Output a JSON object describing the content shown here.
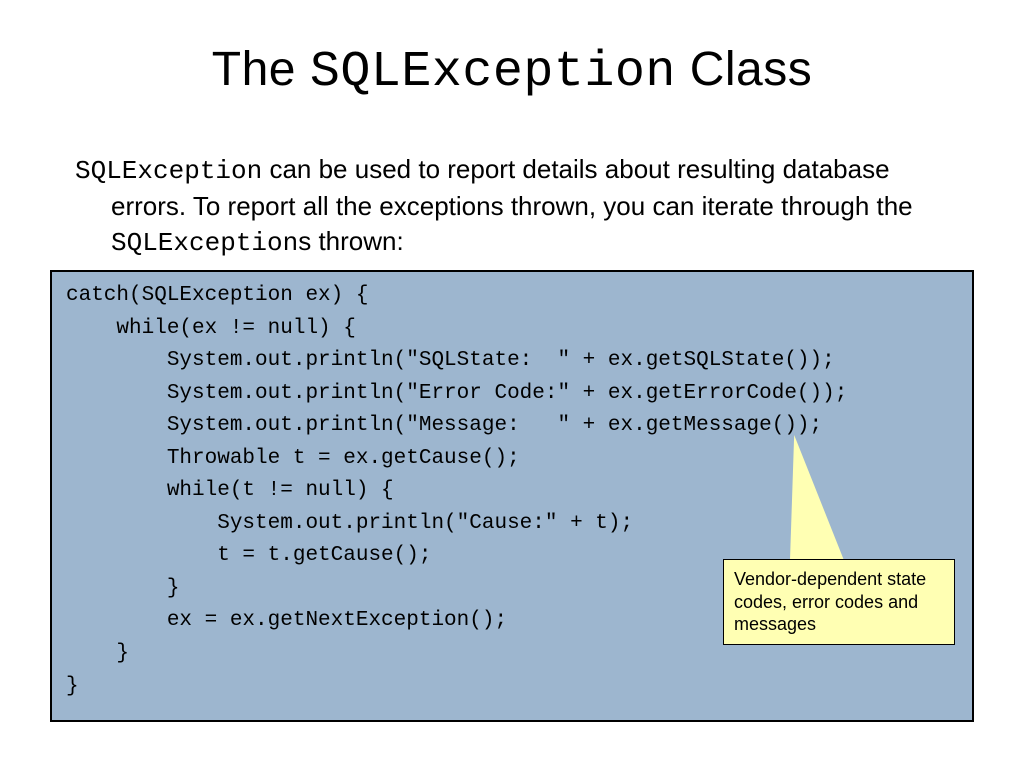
{
  "title": {
    "pre": "The ",
    "mono": "SQLException",
    "post": " Class"
  },
  "desc": {
    "mono1": "SQLException",
    "part1a": " can be used to report details about resulting",
    "part1b": "database errors. To report all the exceptions thrown, you",
    "part2a": "can iterate through the ",
    "mono2": "SQLException",
    "part2b": "s thrown:"
  },
  "code": "catch(SQLException ex) {\n    while(ex != null) {\n        System.out.println(\"SQLState:  \" + ex.getSQLState());\n        System.out.println(\"Error Code:\" + ex.getErrorCode());\n        System.out.println(\"Message:   \" + ex.getMessage());\n        Throwable t = ex.getCause();\n        while(t != null) {\n            System.out.println(\"Cause:\" + t);\n            t = t.getCause();\n        }\n        ex = ex.getNextException();\n    }\n}",
  "callout": "Vendor-dependent state codes, error codes and messages"
}
